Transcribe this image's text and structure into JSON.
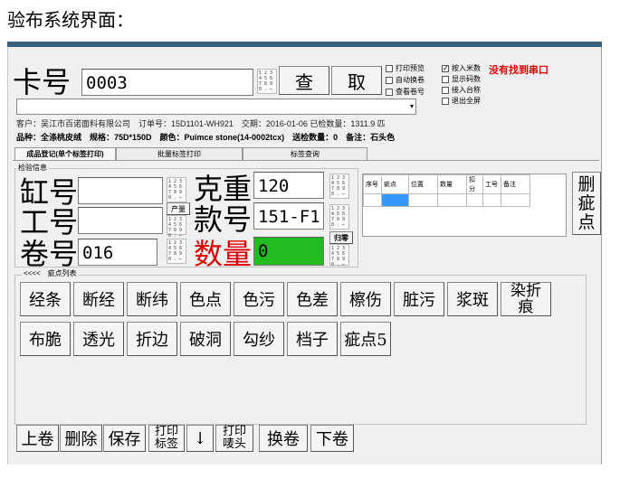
{
  "caption": "验布系统界面：",
  "card": {
    "label": "卡号",
    "value": "0003",
    "query": "查",
    "fetch": "取"
  },
  "checks": [
    {
      "label": "打印预览",
      "checked": false
    },
    {
      "label": "自动换卷",
      "checked": false
    },
    {
      "label": "查看卷号",
      "checked": false
    }
  ],
  "checks2": [
    {
      "label": "按入米数",
      "checked": true
    },
    {
      "label": "显示码数",
      "checked": false
    },
    {
      "label": "接入台称",
      "checked": false
    },
    {
      "label": "退出全屏",
      "checked": false
    }
  ],
  "serial_status": "没有找到串口",
  "order_line": "客户：吴江市百诺面料有限公司　订单号：15D1101-WH921　交期：2016-01-06 已检数量：1311.9 匹",
  "product_line": "品种：全涤桃皮绒　规格：75D*150D　颜色：Puimce stone(14-0002tcx)　送检数量：0　备注：石头色",
  "tabs": [
    "成品登记(单个标签打印)",
    "批量标签打印",
    "标签查询"
  ],
  "group_inspect": "检验信息",
  "fields": {
    "vat_label": "缸号",
    "vat_value": "",
    "worker_label": "工号",
    "worker_value": "",
    "roll_label": "卷号",
    "roll_value": "016",
    "weight_label": "克重",
    "weight_value": "120",
    "style_label": "款号",
    "style_value": "151-F1",
    "qty_label": "数量",
    "qty_value": "0",
    "output_button": "产量",
    "reset_button": "归零"
  },
  "defect_table": {
    "headers": [
      "序号",
      "疵点",
      "位置",
      "数量",
      "扣分",
      "工号",
      "备注"
    ]
  },
  "delete_defect": "删疵点",
  "defect_group": "<<<<　疵点列表",
  "defects_row1": [
    "经条",
    "断经",
    "断纬",
    "色点",
    "色污",
    "色差",
    "檫伤",
    "脏污",
    "浆斑",
    "染折痕"
  ],
  "defects_row2": [
    "布脆",
    "透光",
    "折边",
    "破洞",
    "勾纱",
    "档子",
    "疵点5"
  ],
  "bottom_buttons": [
    "上卷",
    "删除",
    "保存",
    "打印标签",
    "↓",
    "打印唛头",
    "换卷",
    "下卷"
  ],
  "keypad_text": "1 2 3 4 5 6 7 8 9 0 . ←",
  "colors": {
    "green": "#22bb22",
    "red": "#e00000",
    "bar": "#3a5f7a"
  }
}
